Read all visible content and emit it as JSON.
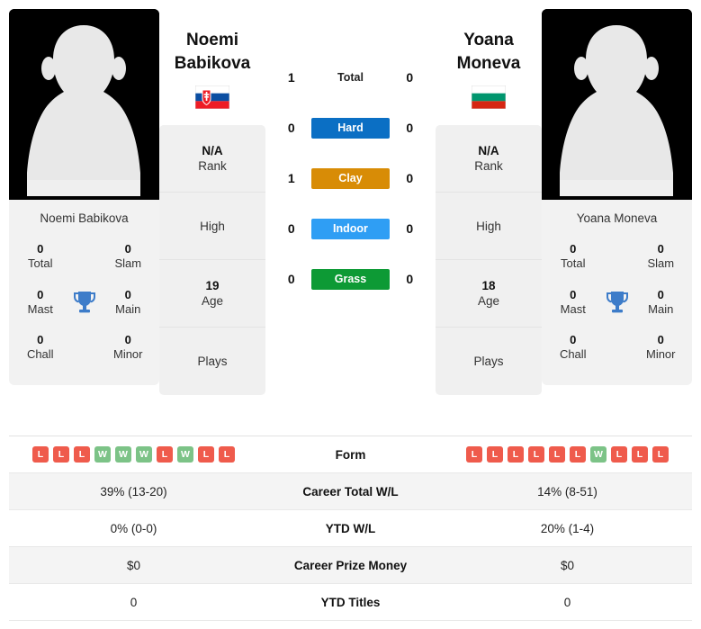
{
  "players": {
    "left": {
      "first_name": "Noemi",
      "last_name": "Babikova",
      "full_name": "Noemi Babikova",
      "country": "Slovakia",
      "flag_icon": "slovakia-flag-icon",
      "rank": "N/A",
      "rank_label": "Rank",
      "high_value": "",
      "high_label": "High",
      "age": "19",
      "age_label": "Age",
      "plays_value": "",
      "plays_label": "Plays",
      "titles": {
        "total": "0",
        "total_label": "Total",
        "slam": "0",
        "slam_label": "Slam",
        "mast": "0",
        "mast_label": "Mast",
        "main": "0",
        "main_label": "Main",
        "chall": "0",
        "chall_label": "Chall",
        "minor": "0",
        "minor_label": "Minor"
      }
    },
    "right": {
      "first_name": "Yoana",
      "last_name": "Moneva",
      "full_name": "Yoana Moneva",
      "country": "Bulgaria",
      "flag_icon": "bulgaria-flag-icon",
      "rank": "N/A",
      "rank_label": "Rank",
      "high_value": "",
      "high_label": "High",
      "age": "18",
      "age_label": "Age",
      "plays_value": "",
      "plays_label": "Plays",
      "titles": {
        "total": "0",
        "total_label": "Total",
        "slam": "0",
        "slam_label": "Slam",
        "mast": "0",
        "mast_label": "Mast",
        "main": "0",
        "main_label": "Main",
        "chall": "0",
        "chall_label": "Chall",
        "minor": "0",
        "minor_label": "Minor"
      }
    }
  },
  "head_to_head": [
    {
      "label": "Total",
      "left": "1",
      "right": "0",
      "color": "",
      "is_pill": false
    },
    {
      "label": "Hard",
      "left": "0",
      "right": "0",
      "color": "#0b6fc4",
      "is_pill": true
    },
    {
      "label": "Clay",
      "left": "1",
      "right": "0",
      "color": "#d88c06",
      "is_pill": true
    },
    {
      "label": "Indoor",
      "left": "0",
      "right": "0",
      "color": "#2f9ef4",
      "is_pill": true
    },
    {
      "label": "Grass",
      "left": "0",
      "right": "0",
      "color": "#0d9a35",
      "is_pill": true
    }
  ],
  "stats_rows": [
    {
      "label": "Form",
      "type": "form",
      "left_form": [
        "L",
        "L",
        "L",
        "W",
        "W",
        "W",
        "L",
        "W",
        "L",
        "L"
      ],
      "right_form": [
        "L",
        "L",
        "L",
        "L",
        "L",
        "L",
        "W",
        "L",
        "L",
        "L"
      ]
    },
    {
      "label": "Career Total W/L",
      "type": "text",
      "left": "39% (13-20)",
      "right": "14% (8-51)"
    },
    {
      "label": "YTD W/L",
      "type": "text",
      "left": "0% (0-0)",
      "right": "20% (1-4)"
    },
    {
      "label": "Career Prize Money",
      "type": "text",
      "left": "$0",
      "right": "$0"
    },
    {
      "label": "YTD Titles",
      "type": "text",
      "left": "0",
      "right": "0"
    }
  ],
  "colors": {
    "win_badge": "#7cc387",
    "loss_badge": "#ef5b4c",
    "trophy": "#3d7cc9",
    "card_bg": "#f0f0f0",
    "row_alt": "#f4f4f4"
  },
  "icons": {
    "trophy": "trophy-icon",
    "avatar": "player-avatar-placeholder-icon"
  }
}
